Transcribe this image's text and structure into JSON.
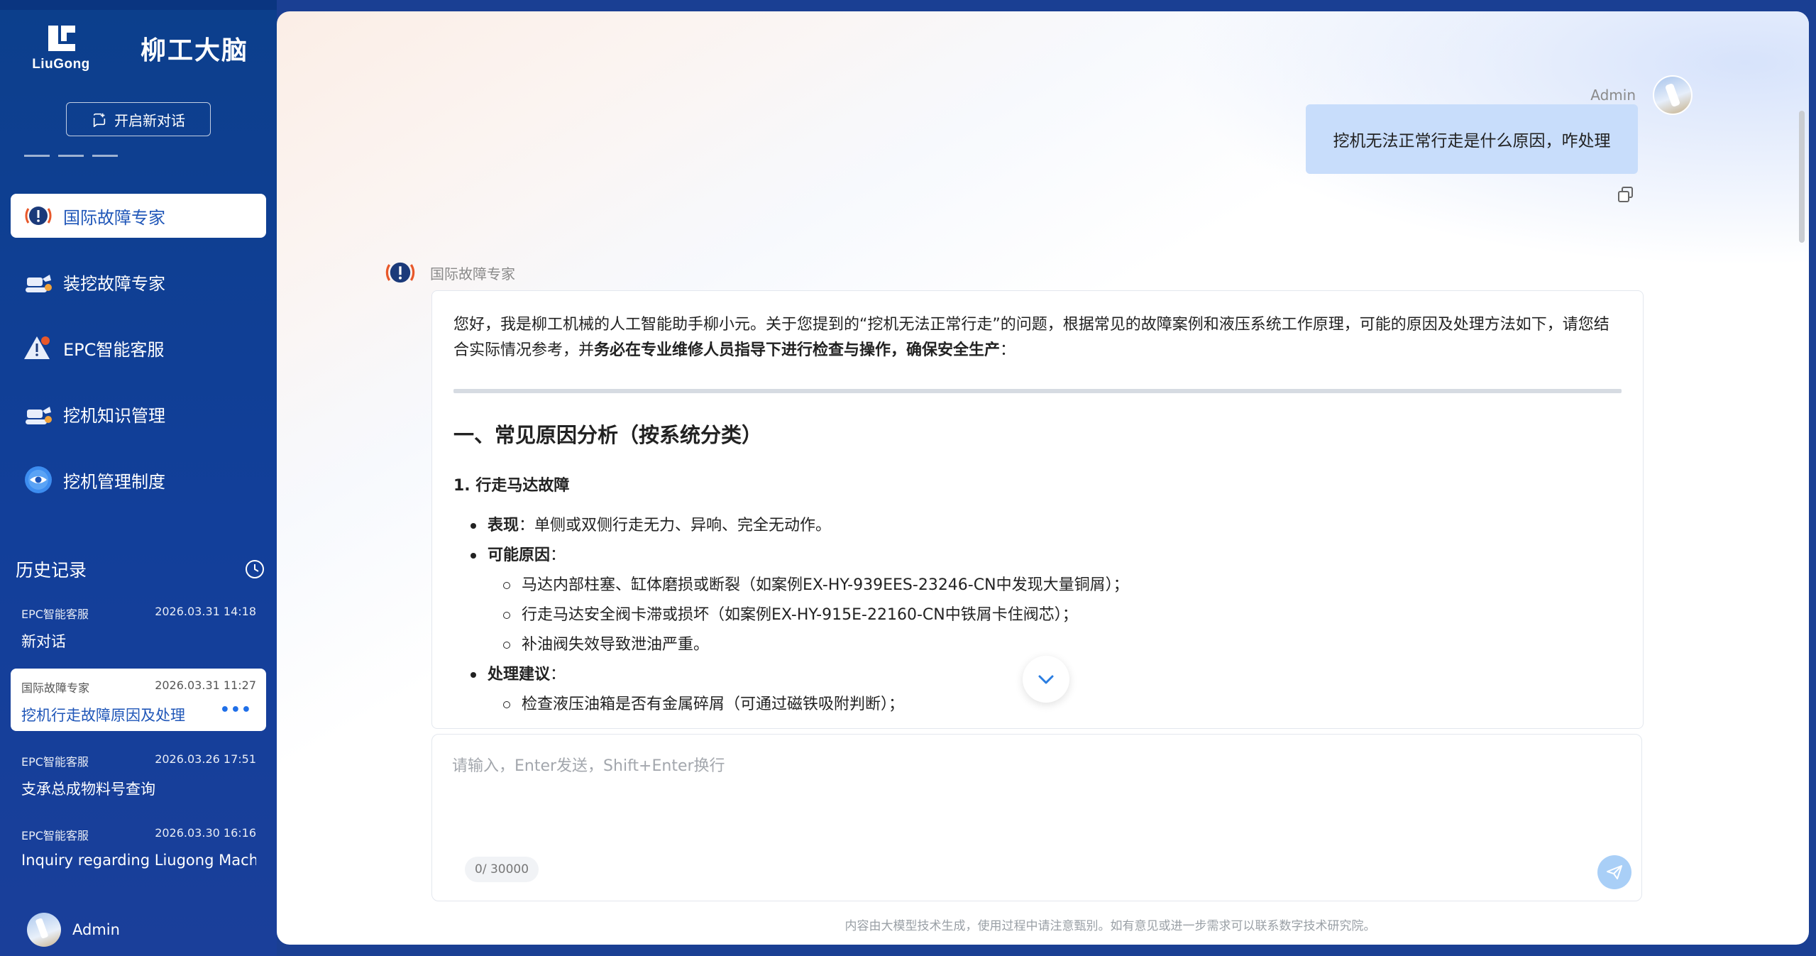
{
  "brand": {
    "logo_text": "LiuGong",
    "name": "柳工大脑"
  },
  "sidebar": {
    "new_chat_label": "开启新对话",
    "nav_items": [
      {
        "label": "国际故障专家",
        "icon": "alert-badge-icon",
        "active": true
      },
      {
        "label": "装挖故障专家",
        "icon": "excavator-icon",
        "active": false
      },
      {
        "label": "EPC智能客服",
        "icon": "warning-triangle-icon",
        "active": false
      },
      {
        "label": "挖机知识管理",
        "icon": "excavator-icon",
        "active": false
      },
      {
        "label": "挖机管理制度",
        "icon": "eye-circle-icon",
        "active": false
      }
    ],
    "history_title": "历史记录",
    "history": [
      {
        "agent": "EPC智能客服",
        "time": "2026.03.31 14:18",
        "title": "新对话",
        "active": false
      },
      {
        "agent": "国际故障专家",
        "time": "2026.03.31 11:27",
        "title": "挖机行走故障原因及处理",
        "active": true,
        "more": "•••"
      },
      {
        "agent": "EPC智能客服",
        "time": "2026.03.26 17:51",
        "title": "支承总成物料号查询",
        "active": false
      },
      {
        "agent": "EPC智能客服",
        "time": "2026.03.30 16:16",
        "title": "Inquiry regarding Liugong Machiner",
        "active": false
      }
    ],
    "user_name": "Admin"
  },
  "chat": {
    "user_name": "Admin",
    "user_message": "挖机无法正常行走是什么原因，咋处理",
    "bot_name": "国际故障专家",
    "answer": {
      "intro_plain": "您好，我是柳工机械的人工智能助手柳小元。关于您提到的“挖机无法正常行走”的问题，根据常见的故障案例和液压系统工作原理，可能的原因及处理方法如下，请您结合实际情况参考，并",
      "intro_bold": "务必在专业维修人员指导下进行检查与操作，确保安全生产",
      "intro_end": "：",
      "section_title": "一、常见原因分析（按系统分类）",
      "sub_title": "1. 行走马达故障",
      "symptom_label": "表现",
      "symptom_text": "：单侧或双侧行走无力、异响、完全无动作。",
      "causes_label": "可能原因",
      "causes_colon": "：",
      "causes": [
        "马达内部柱塞、缸体磨损或断裂（如案例EX-HY-939EES-23246-CN中发现大量铜屑）；",
        "行走马达安全阀卡滞或损坏（如案例EX-HY-915E-22160-CN中铁屑卡住阀芯）；",
        "补油阀失效导致泄油严重。"
      ],
      "advice_label": "处理建议",
      "advice_colon": "：",
      "advice": [
        "检查液压油箱是否有金属碎屑（可通过磁铁吸附判断）；"
      ]
    }
  },
  "composer": {
    "placeholder": "请输入，Enter发送，Shift+Enter换行",
    "counter": "0/ 30000"
  },
  "footer_note": "内容由大模型技术生成，使用过程中请注意甄别。如有意见或进一步需求可以联系数字技术研究院。",
  "colors": {
    "sidebar_bg": "#123f9a",
    "accent_blue": "#1f56b8",
    "user_bubble": "#c8ddfb",
    "alert_orange": "#e8582a",
    "send_button": "#a9cff7"
  }
}
